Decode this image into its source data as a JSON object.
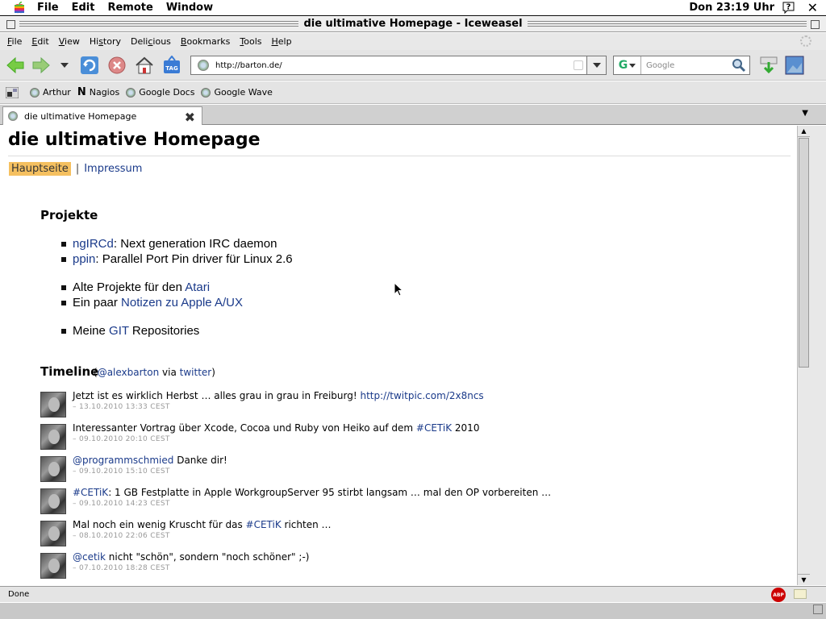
{
  "os_menubar": {
    "menus": [
      "File",
      "Edit",
      "Remote",
      "Window"
    ],
    "clock": "Don 23:19 Uhr"
  },
  "window": {
    "title": "die ultimative Homepage - Iceweasel"
  },
  "browser_menus": [
    {
      "pre": "",
      "u": "F",
      "post": "ile"
    },
    {
      "pre": "",
      "u": "E",
      "post": "dit"
    },
    {
      "pre": "",
      "u": "V",
      "post": "iew"
    },
    {
      "pre": "Hi",
      "u": "s",
      "post": "tory"
    },
    {
      "pre": "Deli",
      "u": "c",
      "post": "ious"
    },
    {
      "pre": "",
      "u": "B",
      "post": "ookmarks"
    },
    {
      "pre": "",
      "u": "T",
      "post": "ools"
    },
    {
      "pre": "",
      "u": "H",
      "post": "elp"
    }
  ],
  "navbar": {
    "url": "http://barton.de/",
    "search_placeholder": "Google",
    "search_engine_letter": "G"
  },
  "bookmarks": [
    "Arthur",
    "Nagios",
    "Google Docs",
    "Google Wave"
  ],
  "tabs": [
    {
      "label": "die ultimative Homepage"
    }
  ],
  "page": {
    "title": "die ultimative Homepage",
    "nav": {
      "active": "Hauptseite",
      "sep": "|",
      "link": "Impressum"
    },
    "projects_heading": "Projekte",
    "projects": [
      [
        {
          "link": "ngIRCd"
        },
        {
          "text": ": Next generation IRC daemon"
        }
      ],
      [
        {
          "link": "ppin"
        },
        {
          "text": ": Parallel Port Pin driver für Linux 2.6"
        }
      ],
      [
        {
          "text": "Alte Projekte für den "
        },
        {
          "link": "Atari"
        }
      ],
      [
        {
          "text": "Ein paar "
        },
        {
          "link": "Notizen zu Apple A/UX"
        }
      ],
      [
        {
          "text": "Meine "
        },
        {
          "link": "GIT"
        },
        {
          "text": " Repositories"
        }
      ]
    ],
    "timeline_heading": "Timeline",
    "timeline_sub": [
      {
        "text": "("
      },
      {
        "link": "@alexbarton"
      },
      {
        "text": " via "
      },
      {
        "link": "twitter"
      },
      {
        "text": ")"
      }
    ],
    "tweets": [
      {
        "parts": [
          {
            "text": "Jetzt ist es wirklich Herbst … alles grau in grau in Freiburg! "
          },
          {
            "link": "http://twitpic.com/2x8ncs"
          }
        ],
        "time": "– 13.10.2010 13:33 CEST"
      },
      {
        "parts": [
          {
            "text": "Interessanter Vortrag über Xcode, Cocoa und Ruby von Heiko auf dem "
          },
          {
            "link": "#CETiK"
          },
          {
            "text": " 2010"
          }
        ],
        "time": "– 09.10.2010 20:10 CEST"
      },
      {
        "parts": [
          {
            "link": "@programmschmied"
          },
          {
            "text": " Danke dir!"
          }
        ],
        "time": "– 09.10.2010 15:10 CEST"
      },
      {
        "parts": [
          {
            "link": "#CETiK"
          },
          {
            "text": ": 1 GB Festplatte in Apple WorkgroupServer 95 stirbt langsam … mal den OP vorbereiten …"
          }
        ],
        "time": "– 09.10.2010 14:23 CEST"
      },
      {
        "parts": [
          {
            "text": "Mal noch ein wenig Kruscht für das "
          },
          {
            "link": "#CETiK"
          },
          {
            "text": " richten …"
          }
        ],
        "time": "– 08.10.2010 22:06 CEST"
      },
      {
        "parts": [
          {
            "link": "@cetik"
          },
          {
            "text": " nicht \"schön\", sondern \"noch schöner\" ;-)"
          }
        ],
        "time": "– 07.10.2010 18:28 CEST"
      }
    ]
  },
  "status": {
    "text": "Done",
    "abp_label": "ABP"
  },
  "colors": {
    "link": "#1a3a8a",
    "nav_active_bg": "#f5c060",
    "abp": "#cc0000"
  }
}
